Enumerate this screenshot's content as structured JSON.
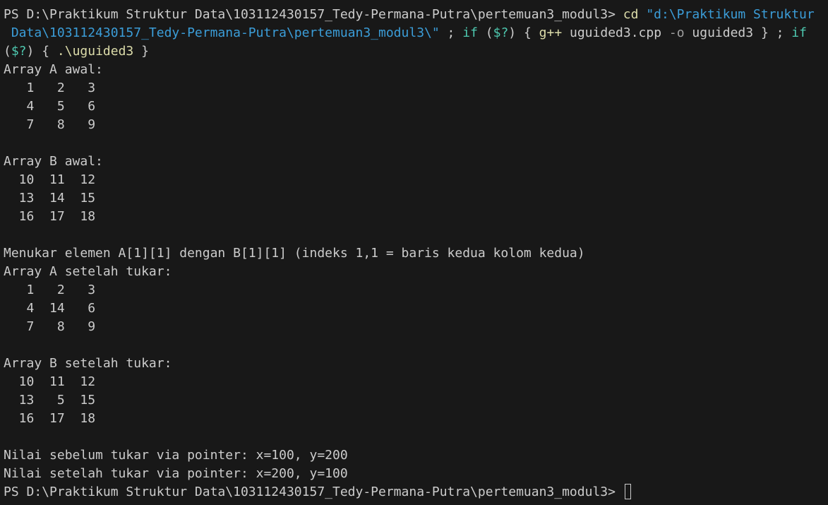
{
  "terminal": {
    "prompt": "PS D:\\Praktikum Struktur Data\\103112430157_Tedy-Permana-Putra\\pertemuan3_modul3> ",
    "command": {
      "cd": "cd",
      "path_part1": " \"d:\\Praktikum Struktur",
      "path_part2": " Data\\103112430157_Tedy-Permana-Putra\\pertemuan3_modul3\\\"",
      "sep1": " ; ",
      "if1": "if",
      "cond1_open": " (",
      "cond1": "$?",
      "cond1_close": ") { ",
      "gpp": "g++",
      "src": " uguided3.cpp ",
      "flag": "-o",
      "out": " uguided3 } ; ",
      "if2": "if",
      "cond2_open": "(",
      "cond2": "$?",
      "cond2_close": ") { ",
      "run": ".\\uguided3",
      "run_close": " }"
    },
    "output": [
      "Array A awal:",
      "   1   2   3",
      "   4   5   6",
      "   7   8   9",
      "",
      "Array B awal:",
      "  10  11  12",
      "  13  14  15",
      "  16  17  18",
      "",
      "Menukar elemen A[1][1] dengan B[1][1] (indeks 1,1 = baris kedua kolom kedua)",
      "Array A setelah tukar:",
      "   1   2   3",
      "   4  14   6",
      "   7   8   9",
      "",
      "Array B setelah tukar:",
      "  10  11  12",
      "  13   5  15",
      "  16  17  18",
      "",
      "Nilai sebelum tukar via pointer: x=100, y=200",
      "Nilai setelah tukar via pointer: x=200, y=100"
    ],
    "final_prompt": "PS D:\\Praktikum Struktur Data\\103112430157_Tedy-Permana-Putra\\pertemuan3_modul3> "
  }
}
